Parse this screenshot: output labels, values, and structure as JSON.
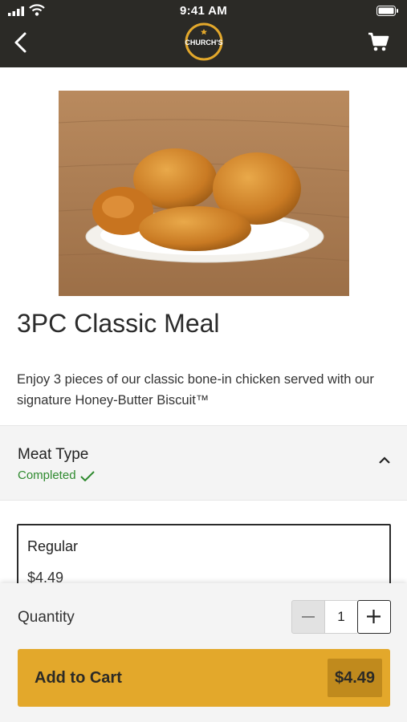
{
  "status_bar": {
    "time": "9:41 AM"
  },
  "header": {
    "logo_text": "CHURCH'S"
  },
  "product": {
    "title": "3PC Classic Meal",
    "description": "Enjoy 3 pieces of our classic bone-in chicken served with our signature Honey-Butter Biscuit™"
  },
  "section": {
    "label": "Meat Type",
    "status": "Completed"
  },
  "option": {
    "name": "Regular",
    "price": "$4.49"
  },
  "quantity": {
    "label": "Quantity",
    "value": "1"
  },
  "add_to_cart": {
    "label": "Add to Cart",
    "price": "$4.49"
  },
  "colors": {
    "header_bg": "#2b2a26",
    "accent": "#e3a82b",
    "completed": "#2f8a2f"
  },
  "icons": [
    "signal-icon",
    "wifi-icon",
    "battery-icon",
    "back-arrow-icon",
    "churchs-logo",
    "cart-icon",
    "check-icon",
    "chevron-up-icon",
    "minus-icon",
    "plus-icon"
  ]
}
